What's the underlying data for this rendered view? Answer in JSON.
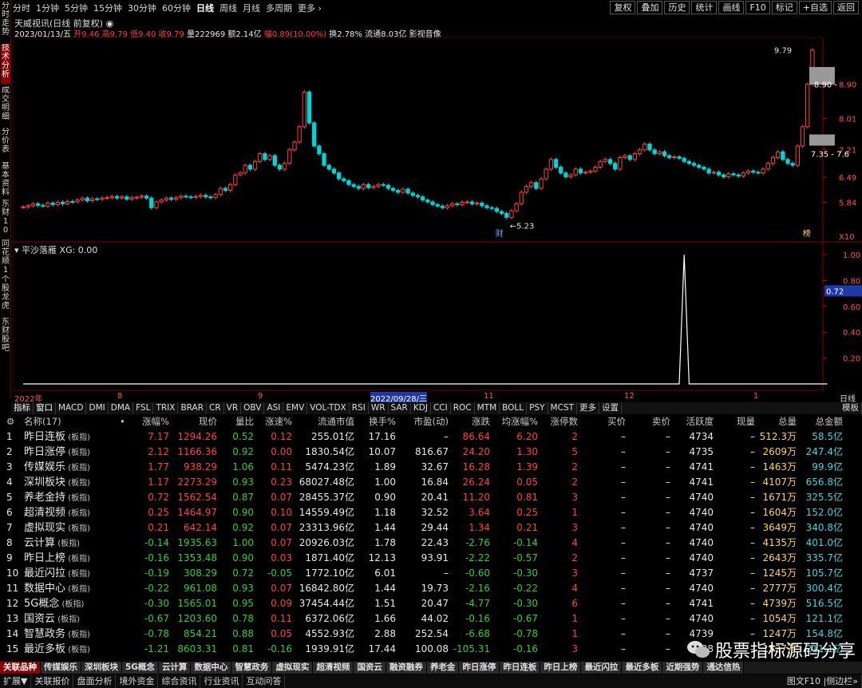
{
  "sidebar": [
    "分时走势",
    "技术分析",
    "成交明细",
    "分价表",
    "基本资料",
    "东财10",
    "同花顺10",
    "个股龙虎",
    "东财股吧"
  ],
  "sidebar_active": 1,
  "periods": [
    "分时",
    "1分钟",
    "5分钟",
    "15分钟",
    "30分钟",
    "60分钟",
    "日线",
    "周线",
    "月线",
    "多周期",
    "更多 ›"
  ],
  "period_active": 6,
  "tools": [
    "复权",
    "叠加",
    "历史",
    "统计",
    "画线",
    "F10",
    "标记",
    "+自选",
    "返回"
  ],
  "stock": {
    "name": "天威视讯(日线 前复权) ◉",
    "date": "2023/01/13/五",
    "open_l": "开",
    "open": "9.46",
    "high_l": "高",
    "high": "9.79",
    "low_l": "低",
    "low": "9.40",
    "close_l": "收",
    "close": "9.79",
    "vol_l": "量",
    "vol": "222969",
    "amt_l": "额",
    "amt": "2.14亿",
    "chg_l": "幅",
    "chg": "0.89(10.00%)",
    "turn_l": "换",
    "turn": "2.78%",
    "float_l": "流通",
    "float": "8.03亿",
    "extra": "影视音像"
  },
  "price_axis": [
    "8.90",
    "8.01",
    "7.21",
    "6.49",
    "5.84"
  ],
  "price_marks": {
    "high": "9.79",
    "box1": "8.90 -",
    "box2": "7.35 - 7.6",
    "low": "5.23"
  },
  "x10": "X10",
  "caifu": "财",
  "mark": "榜",
  "indicator": {
    "name": "平沙落雁",
    "val": "XG: 0.00",
    "axis": [
      "1.00",
      "0.80",
      "0.60",
      "0.40",
      "0.20"
    ],
    "cur": "0.72"
  },
  "time_axis": [
    "2022年",
    "8",
    "9",
    "2022/09/28/三",
    "11",
    "12",
    "1"
  ],
  "ind_tabs": [
    "指标",
    "窗口",
    "MACD",
    "DMI",
    "DMA",
    "FSL",
    "TRIX",
    "BRAR",
    "CR",
    "VR",
    "OBV",
    "ASI",
    "EMV",
    "VOL-TDX",
    "RSI",
    "WR",
    "SAR",
    "KDJ",
    "CCI",
    "ROC",
    "MTM",
    "BOLL",
    "PSY",
    "MCST",
    "更多",
    "设置"
  ],
  "rline": {
    "day": "日线",
    "tpl": "模板"
  },
  "table": {
    "headers": [
      "名称(17)",
      "•",
      "涨幅%",
      "现价",
      "量比",
      "涨速%",
      "流通市值",
      "换手%",
      "市盈(动)",
      "涨跌",
      "均涨幅%",
      "涨停数",
      "买价",
      "卖价",
      "活跃度",
      "现量",
      "总量",
      "总金额"
    ],
    "rows": [
      [
        "1",
        "昨日连板",
        "(板指)",
        "7.17",
        "1294.26",
        "0.52",
        "0.12",
        "255.01亿",
        "17.16",
        "–",
        "86.64",
        "6.20",
        "2",
        "–",
        "–",
        "4734",
        "–",
        "512.3万",
        "58.5亿"
      ],
      [
        "2",
        "昨日涨停",
        "(板指)",
        "2.12",
        "1166.36",
        "0.92",
        "0.00",
        "1830.54亿",
        "10.07",
        "816.67",
        "24.20",
        "1.30",
        "5",
        "–",
        "–",
        "4735",
        "–",
        "2609万",
        "247.4亿"
      ],
      [
        "3",
        "传媒娱乐",
        "(板指)",
        "1.77",
        "938.29",
        "1.06",
        "0.11",
        "5474.23亿",
        "1.89",
        "32.67",
        "16.28",
        "1.39",
        "2",
        "–",
        "–",
        "4741",
        "–",
        "1463万",
        "99.9亿"
      ],
      [
        "4",
        "深圳板块",
        "(板指)",
        "1.17",
        "2273.29",
        "0.93",
        "0.23",
        "68027.48亿",
        "1.00",
        "16.84",
        "26.24",
        "0.05",
        "2",
        "–",
        "–",
        "4741",
        "–",
        "4107万",
        "656.8亿"
      ],
      [
        "5",
        "养老金持",
        "(板指)",
        "0.72",
        "1562.54",
        "0.87",
        "0.07",
        "28455.37亿",
        "0.90",
        "20.41",
        "11.20",
        "0.81",
        "3",
        "–",
        "–",
        "4740",
        "–",
        "1671万",
        "325.5亿"
      ],
      [
        "6",
        "超清视频",
        "(板指)",
        "0.25",
        "1464.97",
        "0.90",
        "0.10",
        "14559.49亿",
        "1.18",
        "32.52",
        "3.64",
        "0.25",
        "1",
        "–",
        "–",
        "4740",
        "–",
        "1604万",
        "152.0亿"
      ],
      [
        "7",
        "虚拟现实",
        "(板指)",
        "0.21",
        "642.14",
        "0.92",
        "0.07",
        "23313.96亿",
        "1.44",
        "29.44",
        "1.34",
        "0.21",
        "3",
        "–",
        "–",
        "4740",
        "–",
        "3649万",
        "340.8亿"
      ],
      [
        "8",
        "云计算",
        "(板指)",
        "-0.14",
        "1935.63",
        "1.00",
        "0.07",
        "20926.03亿",
        "1.78",
        "22.43",
        "-2.76",
        "-0.14",
        "4",
        "–",
        "–",
        "4740",
        "–",
        "4135万",
        "401.0亿"
      ],
      [
        "9",
        "昨日上榜",
        "(板指)",
        "-0.16",
        "1353.48",
        "0.90",
        "0.03",
        "1871.40亿",
        "12.13",
        "93.91",
        "-2.22",
        "-0.57",
        "2",
        "–",
        "–",
        "4740",
        "–",
        "2643万",
        "335.7亿"
      ],
      [
        "10",
        "最近闪拉",
        "(板指)",
        "-0.19",
        "308.29",
        "0.72",
        "-0.05",
        "1772.10亿",
        "6.01",
        "–",
        "-0.60",
        "-0.30",
        "3",
        "–",
        "–",
        "4737",
        "–",
        "1245万",
        "105.7亿"
      ],
      [
        "11",
        "数据中心",
        "(板指)",
        "-0.22",
        "961.08",
        "0.93",
        "0.07",
        "16842.80亿",
        "1.44",
        "19.73",
        "-2.16",
        "-0.22",
        "4",
        "–",
        "–",
        "4740",
        "–",
        "2777万",
        "300.4亿"
      ],
      [
        "12",
        "5G概念",
        "(板指)",
        "-0.30",
        "1565.01",
        "0.95",
        "0.09",
        "37454.44亿",
        "1.51",
        "20.47",
        "-4.77",
        "-0.30",
        "6",
        "–",
        "–",
        "4741",
        "–",
        "4739万",
        "516.5亿"
      ],
      [
        "13",
        "国资云",
        "(板指)",
        "-0.67",
        "1203.60",
        "0.78",
        "0.11",
        "6372.06亿",
        "1.66",
        "44.02",
        "-0.16",
        "-0.67",
        "1",
        "–",
        "–",
        "4740",
        "–",
        "1054万",
        "121.1亿"
      ],
      [
        "14",
        "智慧政务",
        "(板指)",
        "-0.78",
        "854.21",
        "0.88",
        "0.05",
        "4552.93亿",
        "2.88",
        "252.54",
        "-6.68",
        "-0.78",
        "1",
        "–",
        "–",
        "4739",
        "–",
        "1247万",
        "154.8亿"
      ],
      [
        "15",
        "最近多板",
        "(板指)",
        "-1.21",
        "8603.31",
        "0.81",
        "-0.16",
        "1939.91亿",
        "17.44",
        "100.08",
        "-105.31",
        "-0.16",
        "3",
        "–",
        "–",
        "4738",
        "–",
        "1527万",
        "211.1亿"
      ]
    ]
  },
  "sector_tabs": [
    "关联品种",
    "传媒娱乐",
    "深圳板块",
    "5G概念",
    "云计算",
    "数据中心",
    "智慧政务",
    "虚拟现实",
    "超清视频",
    "国资云",
    "融资融券",
    "养老金",
    "昨日涨停",
    "昨日连板",
    "昨日上榜",
    "最近闪拉",
    "最近多板",
    "近期强势",
    "通达信热"
  ],
  "status_bar": [
    "扩展▼",
    "关联报价",
    "盘面分析",
    "境外资金",
    "综合资讯",
    "行业资讯",
    "互动问答"
  ],
  "status_right": "图文F10 |侧边栏»",
  "watermark": "股票指标源码分享",
  "colors": {
    "up": "#ff4040",
    "down": "#00d4d4",
    "grid": "#5a0000",
    "indicator": "#ffffff"
  },
  "chart_data": [
    {
      "type": "candlestick",
      "title": "天威视讯(日线 前复权)",
      "ylim": [
        5.0,
        9.95
      ],
      "series": [
        {
          "name": "K线",
          "close": [
            5.72,
            5.75,
            5.8,
            5.76,
            5.74,
            5.82,
            5.78,
            5.84,
            5.8,
            5.86,
            5.85,
            5.9,
            5.95,
            5.88,
            5.93,
            5.92,
            5.95,
            5.96,
            5.99,
            5.95,
            5.98,
            5.92,
            5.96,
            5.97,
            6.0,
            5.95,
            5.7,
            5.85,
            5.9,
            5.95,
            5.92,
            5.96,
            6.0,
            5.98,
            5.97,
            5.99,
            6.02,
            5.98,
            5.96,
            6.04,
            6.2,
            6.15,
            6.3,
            6.55,
            6.6,
            6.8,
            6.7,
            6.9,
            7.1,
            6.95,
            7.05,
            6.8,
            6.7,
            6.85,
            7.2,
            7.4,
            7.8,
            8.7,
            7.9,
            7.3,
            7.1,
            6.8,
            6.7,
            6.6,
            6.45,
            6.4,
            6.3,
            6.25,
            6.2,
            6.3,
            6.22,
            6.25,
            6.3,
            6.28,
            6.2,
            6.15,
            6.1,
            6.18,
            6.08,
            6.02,
            5.98,
            5.9,
            5.85,
            5.78,
            5.74,
            5.7,
            5.75,
            5.8,
            5.78,
            5.84,
            5.85,
            5.8,
            5.82,
            5.75,
            5.7,
            5.68,
            5.6,
            5.55,
            5.45,
            5.62,
            5.8,
            6.1,
            6.25,
            6.35,
            6.2,
            6.45,
            6.7,
            6.95,
            6.75,
            6.6,
            6.5,
            6.55,
            6.7,
            6.6,
            6.62,
            6.65,
            6.75,
            6.9,
            6.95,
            6.85,
            6.7,
            7.0,
            7.05,
            6.95,
            7.1,
            7.2,
            7.35,
            7.2,
            7.1,
            7.15,
            7.05,
            7.0,
            7.02,
            6.98,
            6.9,
            6.85,
            6.8,
            6.75,
            6.7,
            6.6,
            6.62,
            6.55,
            6.5,
            6.58,
            6.55,
            6.52,
            6.6,
            6.65,
            6.62,
            6.6,
            6.7,
            6.85,
            7.0,
            7.15,
            6.95,
            6.85,
            6.8,
            7.3,
            7.8,
            8.9,
            9.79
          ]
        }
      ]
    },
    {
      "type": "line",
      "title": "平沙落雁",
      "ylim": [
        0,
        1.05
      ],
      "series": [
        {
          "name": "XG",
          "values": [
            0,
            0,
            0,
            0,
            0,
            0,
            0,
            0,
            0,
            0,
            0,
            0,
            0,
            0,
            0,
            0,
            0,
            0,
            0,
            0,
            0,
            0,
            0,
            0,
            0,
            0,
            0,
            0,
            0,
            0,
            0,
            0,
            0,
            0,
            0,
            0,
            0,
            0,
            0,
            0,
            0,
            0,
            0,
            0,
            0,
            0,
            0,
            0,
            0,
            0,
            0,
            0,
            0,
            0,
            0,
            0,
            0,
            0,
            0,
            0,
            0,
            0,
            0,
            0,
            0,
            0,
            0,
            0,
            0,
            0,
            0,
            0,
            0,
            0,
            0,
            0,
            0,
            0,
            0,
            0,
            0,
            0,
            0,
            0,
            0,
            0,
            0,
            0,
            0,
            0,
            0,
            0,
            0,
            0,
            0,
            0,
            0,
            0,
            0,
            0,
            0,
            0,
            0,
            0,
            0,
            0,
            0,
            0,
            0,
            0,
            0,
            0,
            0,
            0,
            0,
            0,
            0,
            0,
            0,
            0,
            0,
            0,
            0,
            0,
            0,
            0,
            0,
            0,
            0,
            0,
            0,
            0,
            0,
            0,
            1,
            0,
            0,
            0,
            0,
            0,
            0,
            0,
            0,
            0,
            0,
            0,
            0,
            0,
            0,
            0,
            0,
            0,
            0,
            0,
            0,
            0,
            0,
            0,
            0,
            0,
            0,
            0,
            0,
            0
          ]
        }
      ]
    }
  ]
}
